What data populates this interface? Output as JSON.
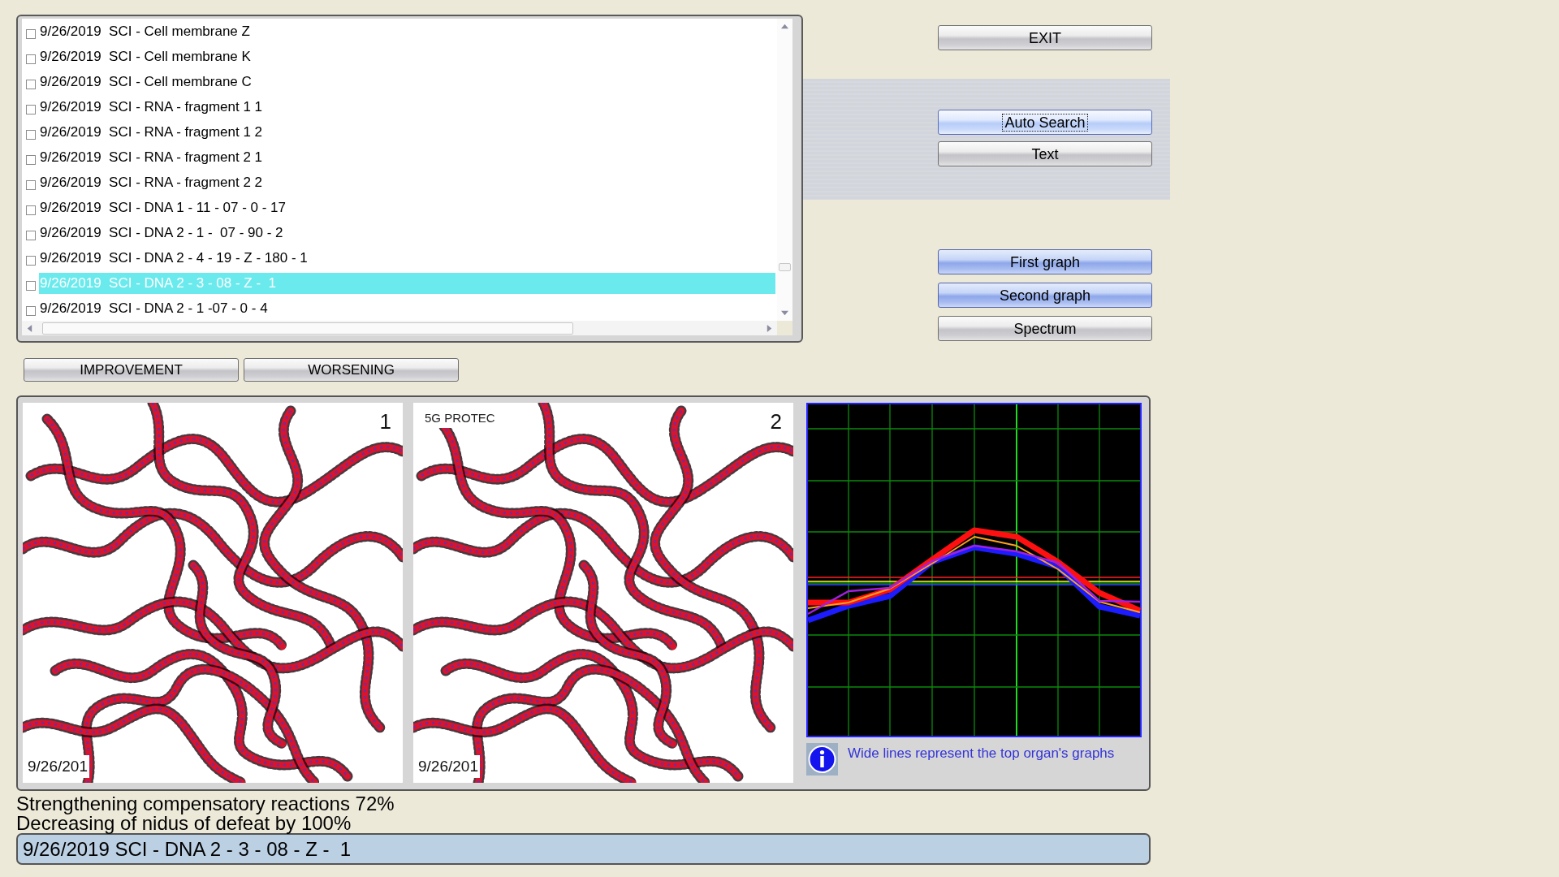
{
  "list": {
    "items": [
      {
        "text": "9/26/2019  SCI - Cell membrane Z",
        "checked": false,
        "selected": false
      },
      {
        "text": "9/26/2019  SCI - Cell membrane K",
        "checked": false,
        "selected": false
      },
      {
        "text": "9/26/2019  SCI - Cell membrane C",
        "checked": false,
        "selected": false
      },
      {
        "text": "9/26/2019  SCI - RNA - fragment 1 1",
        "checked": false,
        "selected": false
      },
      {
        "text": "9/26/2019  SCI - RNA - fragment 1 2",
        "checked": false,
        "selected": false
      },
      {
        "text": "9/26/2019  SCI - RNA - fragment 2 1",
        "checked": false,
        "selected": false
      },
      {
        "text": "9/26/2019  SCI - RNA - fragment 2 2",
        "checked": false,
        "selected": false
      },
      {
        "text": "9/26/2019  SCI - DNA 1 - 11 - 07 - 0 - 17",
        "checked": false,
        "selected": false
      },
      {
        "text": "9/26/2019  SCI - DNA 2 - 1 -  07 - 90 - 2",
        "checked": false,
        "selected": false
      },
      {
        "text": "9/26/2019  SCI - DNA 2 - 4 - 19 - Z - 180 - 1",
        "checked": false,
        "selected": false
      },
      {
        "text": "9/26/2019  SCI - DNA 2 - 3 - 08 - Z -  1",
        "checked": false,
        "selected": true
      },
      {
        "text": "9/26/2019  SCI - DNA 2 - 1 -07 - 0 - 4",
        "checked": false,
        "selected": false
      }
    ]
  },
  "exit_button": {
    "label": "EXIT"
  },
  "search_panel": {
    "buttons": [
      {
        "label": "Auto Search",
        "focused": true
      },
      {
        "label": "Text",
        "focused": false
      }
    ]
  },
  "graph_buttons": [
    {
      "label": "First graph",
      "selected": true
    },
    {
      "label": "Second graph",
      "selected": true
    },
    {
      "label": "Spectrum",
      "selected": false
    }
  ],
  "filter_buttons": [
    {
      "label": "IMPROVEMENT"
    },
    {
      "label": "WORSENING"
    }
  ],
  "images": [
    {
      "panel_number": "1",
      "date": "9/26/201"
    },
    {
      "caption": "5G PROTEC",
      "panel_number": "2",
      "date": "9/26/201"
    }
  ],
  "graph": {
    "note": "Wide lines represent the top organ's graphs"
  },
  "results": [
    "Strengthening compensatory reactions 72%",
    "Decreasing of nidus of defeat by 100%"
  ],
  "status_bar": {
    "text": "9/26/2019 SCI - DNA 2 - 3 - 08 - Z -  1"
  }
}
